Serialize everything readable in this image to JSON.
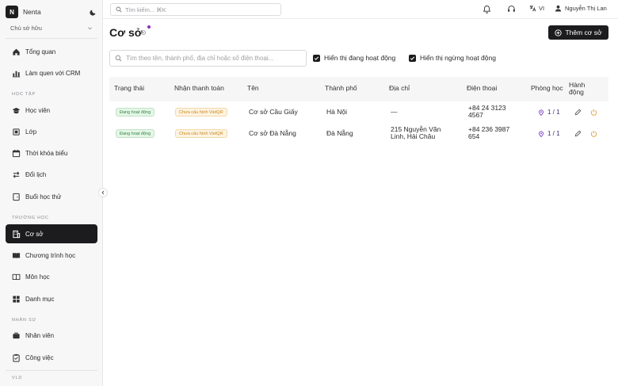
{
  "brand": {
    "logo_letter": "N",
    "name": "Nenta"
  },
  "role": {
    "selected": "Chủ sở hữu"
  },
  "sidebar": {
    "top_items": [
      {
        "label": "Tổng quan",
        "icon": "home-icon"
      },
      {
        "label": "Làm quen với CRM",
        "icon": "chart-icon"
      }
    ],
    "sections": [
      {
        "title": "HỌC TẬP",
        "items": [
          {
            "label": "Học viên",
            "icon": "graduation-cap-icon"
          },
          {
            "label": "Lớp",
            "icon": "layers-icon"
          },
          {
            "label": "Thời khóa biểu",
            "icon": "calendar-icon"
          },
          {
            "label": "Đổi lịch",
            "icon": "swap-icon"
          },
          {
            "label": "Buổi học thử",
            "icon": "door-icon"
          }
        ]
      },
      {
        "title": "TRƯỜNG HỌC",
        "items": [
          {
            "label": "Cơ sở",
            "icon": "building-icon",
            "active": true
          },
          {
            "label": "Chương trình học",
            "icon": "book-icon"
          },
          {
            "label": "Môn học",
            "icon": "open-book-icon"
          },
          {
            "label": "Danh mục",
            "icon": "grid-icon"
          }
        ]
      },
      {
        "title": "NHÂN SỰ",
        "items": [
          {
            "label": "Nhân viên",
            "icon": "briefcase-icon"
          },
          {
            "label": "Công việc",
            "icon": "clipboard-icon"
          }
        ]
      }
    ],
    "footer_label": "VLD"
  },
  "topbar": {
    "search_placeholder": "Tìm kiếm... ⌘K",
    "language": "VI",
    "user_name": "Nguyễn Thị Lan"
  },
  "page": {
    "title": "Cơ sở",
    "add_button": "Thêm cơ sở",
    "filter_placeholder": "Tìm theo tên, thành phố, địa chỉ hoặc số điện thoại...",
    "show_active": "Hiển thị đang hoạt động",
    "show_inactive": "Hiển thị ngừng hoạt động"
  },
  "table": {
    "headers": {
      "status": "Trạng thái",
      "payment": "Nhận thanh toán",
      "name": "Tên",
      "city": "Thành phố",
      "address": "Địa chỉ",
      "phone": "Điện thoại",
      "rooms": "Phòng học",
      "actions": "Hành động"
    },
    "rows": [
      {
        "status": "Đang hoạt động",
        "payment": "Chưa cấu hình VietQR",
        "name": "Cơ sở Cầu Giấy",
        "city": "Hà Nội",
        "address": "—",
        "phone": "+84 24 3123 4567",
        "rooms": "1 / 1"
      },
      {
        "status": "Đang hoạt động",
        "payment": "Chưa cấu hình VietQR",
        "name": "Cơ sở Đà Nẵng",
        "city": "Đà Nẵng",
        "address": "215 Nguyễn Văn Linh, Hải Châu",
        "phone": "+84 236 3987 654",
        "rooms": "1 / 1"
      }
    ]
  },
  "colors": {
    "accent_dark": "#1c1c1e",
    "status_green": "#2e8a3e",
    "warning_amber": "#c98a1d",
    "edit_orange": "#e0a03a",
    "room_purple": "#7b3fc4"
  }
}
